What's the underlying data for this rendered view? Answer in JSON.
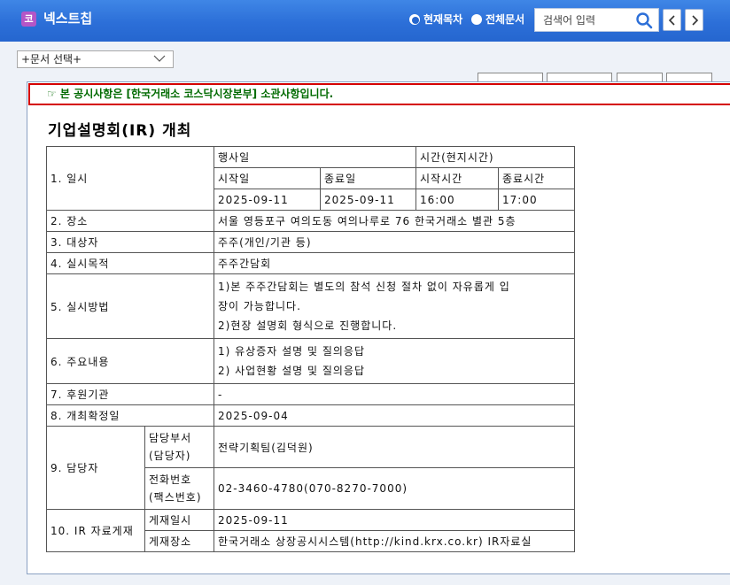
{
  "header": {
    "logo_char": "코",
    "app_title": "넥스트칩",
    "radio_current": "현재목차",
    "radio_all": "전체문서",
    "search_placeholder": "검색어 입력"
  },
  "doc_select": {
    "value": "+문서 선택+"
  },
  "notice": "☞ 본 공시사항은 [한국거래소 코스닥시장본부] 소관사항입니다.",
  "doc_title": "기업설명회(IR) 개최",
  "table": {
    "r1_label": "1. 일시",
    "event_date_header": "행사일",
    "time_header": "시간(현지시간)",
    "start_date_header": "시작일",
    "end_date_header": "종료일",
    "start_time_header": "시작시간",
    "end_time_header": "종료시간",
    "start_date": "2025-09-11",
    "end_date": "2025-09-11",
    "start_time": "16:00",
    "end_time": "17:00",
    "r2_label": "2. 장소",
    "r2_value": "서울 영등포구 여의도동 여의나루로 76 한국거래소 별관 5층",
    "r3_label": "3. 대상자",
    "r3_value": "주주(개인/기관 등)",
    "r4_label": "4. 실시목적",
    "r4_value": "주주간담회",
    "r5_label": "5. 실시방법",
    "r5_line1a": "1)본 주주간담회는 별도의 참석 신청 절차 없이 자유롭게 입",
    "r5_line1b": "장이 가능합니다.",
    "r5_line2": "2)현장 설명회 형식으로 진행합니다.",
    "r6_label": "6. 주요내용",
    "r6_line1": "1) 유상증자 설명 및 질의응답",
    "r6_line2": "2) 사업현황 설명 및 질의응답",
    "r7_label": "7. 후원기관",
    "r7_value": "-",
    "r8_label": "8. 개최확정일",
    "r8_value": "2025-09-04",
    "r9_label": "9. 담당자",
    "dept_label_1": "담당부서",
    "dept_label_2": "(담당자)",
    "dept_value": "전략기획팀(김덕원)",
    "phone_label_1": "전화번호",
    "phone_label_2": "(팩스번호)",
    "phone_value": "02-3460-4780(070-8270-7000)",
    "r10_label": "10. IR 자료게재",
    "post_date_label": "게재일시",
    "post_date_value": "2025-09-11",
    "post_place_label": "게재장소",
    "post_place_value": "한국거래소 상장공시시스템(http://kind.krx.co.kr) IR자료실"
  }
}
